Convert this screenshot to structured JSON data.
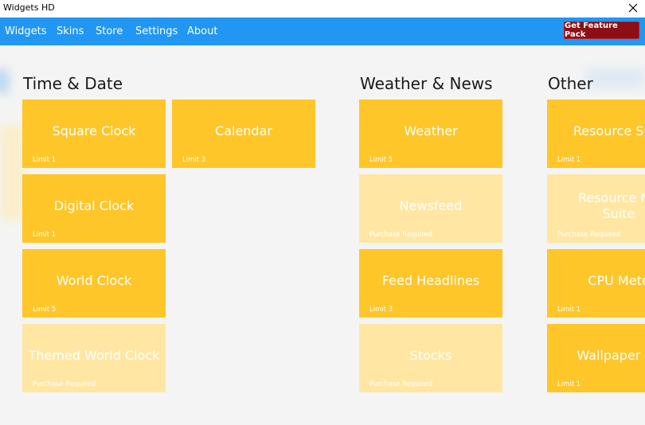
{
  "window": {
    "title": "Widgets HD"
  },
  "nav": {
    "items": [
      {
        "label": "Widgets"
      },
      {
        "label": "Skins"
      },
      {
        "label": "Store"
      },
      {
        "label": "Settings"
      },
      {
        "label": "About"
      }
    ],
    "feature_button": "Get Feature Pack"
  },
  "colors": {
    "nav_bg": "#2196f3",
    "tile_active": "#ffc629",
    "tile_locked": "#ffe7a3",
    "feature_button": "#8b0f14"
  },
  "sections": [
    {
      "title": "Time & Date",
      "tiles": [
        {
          "name": "Square Clock",
          "status": "Limit 1",
          "locked": false
        },
        {
          "name": "Calendar",
          "status": "Limit 3",
          "locked": false
        },
        {
          "name": "Digital Clock",
          "status": "Limit 1",
          "locked": false
        },
        {
          "name": "World Clock",
          "status": "Limit 5",
          "locked": false
        },
        {
          "name": "Themed World Clock",
          "status": "Purchase Required",
          "locked": true
        }
      ]
    },
    {
      "title": "Weather & News",
      "tiles": [
        {
          "name": "Weather",
          "status": "Limit 5",
          "locked": false
        },
        {
          "name": "Newsfeed",
          "status": "Purchase Required",
          "locked": true
        },
        {
          "name": "Feed Headlines",
          "status": "Limit 3",
          "locked": false
        },
        {
          "name": "Stocks",
          "status": "Purchase Required",
          "locked": true
        }
      ]
    },
    {
      "title": "Other",
      "tiles": [
        {
          "name": "Resource Sum",
          "status": "Limit 1",
          "locked": false
        },
        {
          "name": "Resource Mo\nSuite",
          "status": "Purchase Required",
          "locked": true
        },
        {
          "name": "CPU Mete",
          "status": "Limit 1",
          "locked": false
        },
        {
          "name": "Wallpaper Ro",
          "status": "Limit 1",
          "locked": false
        }
      ]
    }
  ]
}
